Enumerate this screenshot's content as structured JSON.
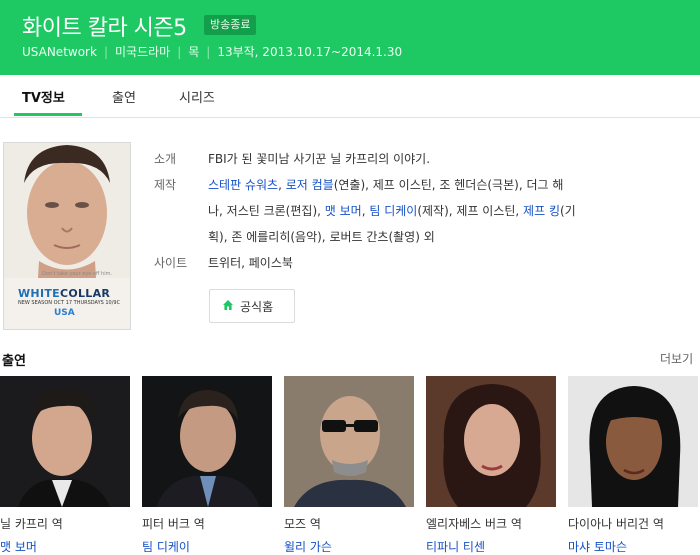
{
  "header": {
    "title": "화이트 칼라 시즌5",
    "status_badge": "방송종료",
    "meta": [
      "USANetwork",
      "미국드라마",
      "목",
      "13부작, 2013.10.17~2014.1.30"
    ]
  },
  "tabs": [
    {
      "label": "TV정보",
      "active": true
    },
    {
      "label": "출연",
      "active": false
    },
    {
      "label": "시리즈",
      "active": false
    }
  ],
  "poster": {
    "small_text": "Don't take your eye off him.",
    "brand_word1": "WHITE",
    "brand_word2": "COLLAR",
    "subtitle": "NEW SEASON OCT 17 THURSDAYS 10/9C",
    "network": "USA"
  },
  "info": {
    "intro_label": "소개",
    "intro_text": "FBI가 된 꽃미남 사기꾼 닐 카프리의 이야기.",
    "staff_label": "제작",
    "staff_line1": [
      {
        "text": "스테판 슈워츠",
        "link": true
      },
      {
        "text": ", ",
        "link": false
      },
      {
        "text": "로저 컴블",
        "link": true
      },
      {
        "text": "(연출), 제프 이스틴, 조 헨더슨(극본), 더그 해",
        "link": false
      }
    ],
    "staff_line2": [
      {
        "text": "나, 저스틴 크론(편집), ",
        "link": false
      },
      {
        "text": "맷 보머",
        "link": true
      },
      {
        "text": ", ",
        "link": false
      },
      {
        "text": "팀 디케이",
        "link": true
      },
      {
        "text": "(제작), 제프 이스틴, ",
        "link": false
      },
      {
        "text": "제프 킹",
        "link": true
      },
      {
        "text": "(기",
        "link": false
      }
    ],
    "staff_line3": [
      {
        "text": "획), 존 에를리히(음악), 로버트 간츠(촬영) 외",
        "link": false
      }
    ],
    "site_label": "사이트",
    "site_links": "트위터, 페이스북",
    "home_button": "공식홈"
  },
  "cast": {
    "title": "출연",
    "more": "더보기",
    "members": [
      {
        "role": "닐 카프리 역",
        "actor": "맷 보머"
      },
      {
        "role": "피터 버크 역",
        "actor": "팀 디케이"
      },
      {
        "role": "모즈 역",
        "actor": "윌리 가슨"
      },
      {
        "role": "엘리자베스 버크 역",
        "actor": "티파니 티센"
      },
      {
        "role": "다이아나 버리건 역",
        "actor": "마샤 토마슨"
      }
    ]
  },
  "colors": {
    "header_green": "#1ec964",
    "badge_green": "#129e4b",
    "link_blue": "#1551c7"
  }
}
